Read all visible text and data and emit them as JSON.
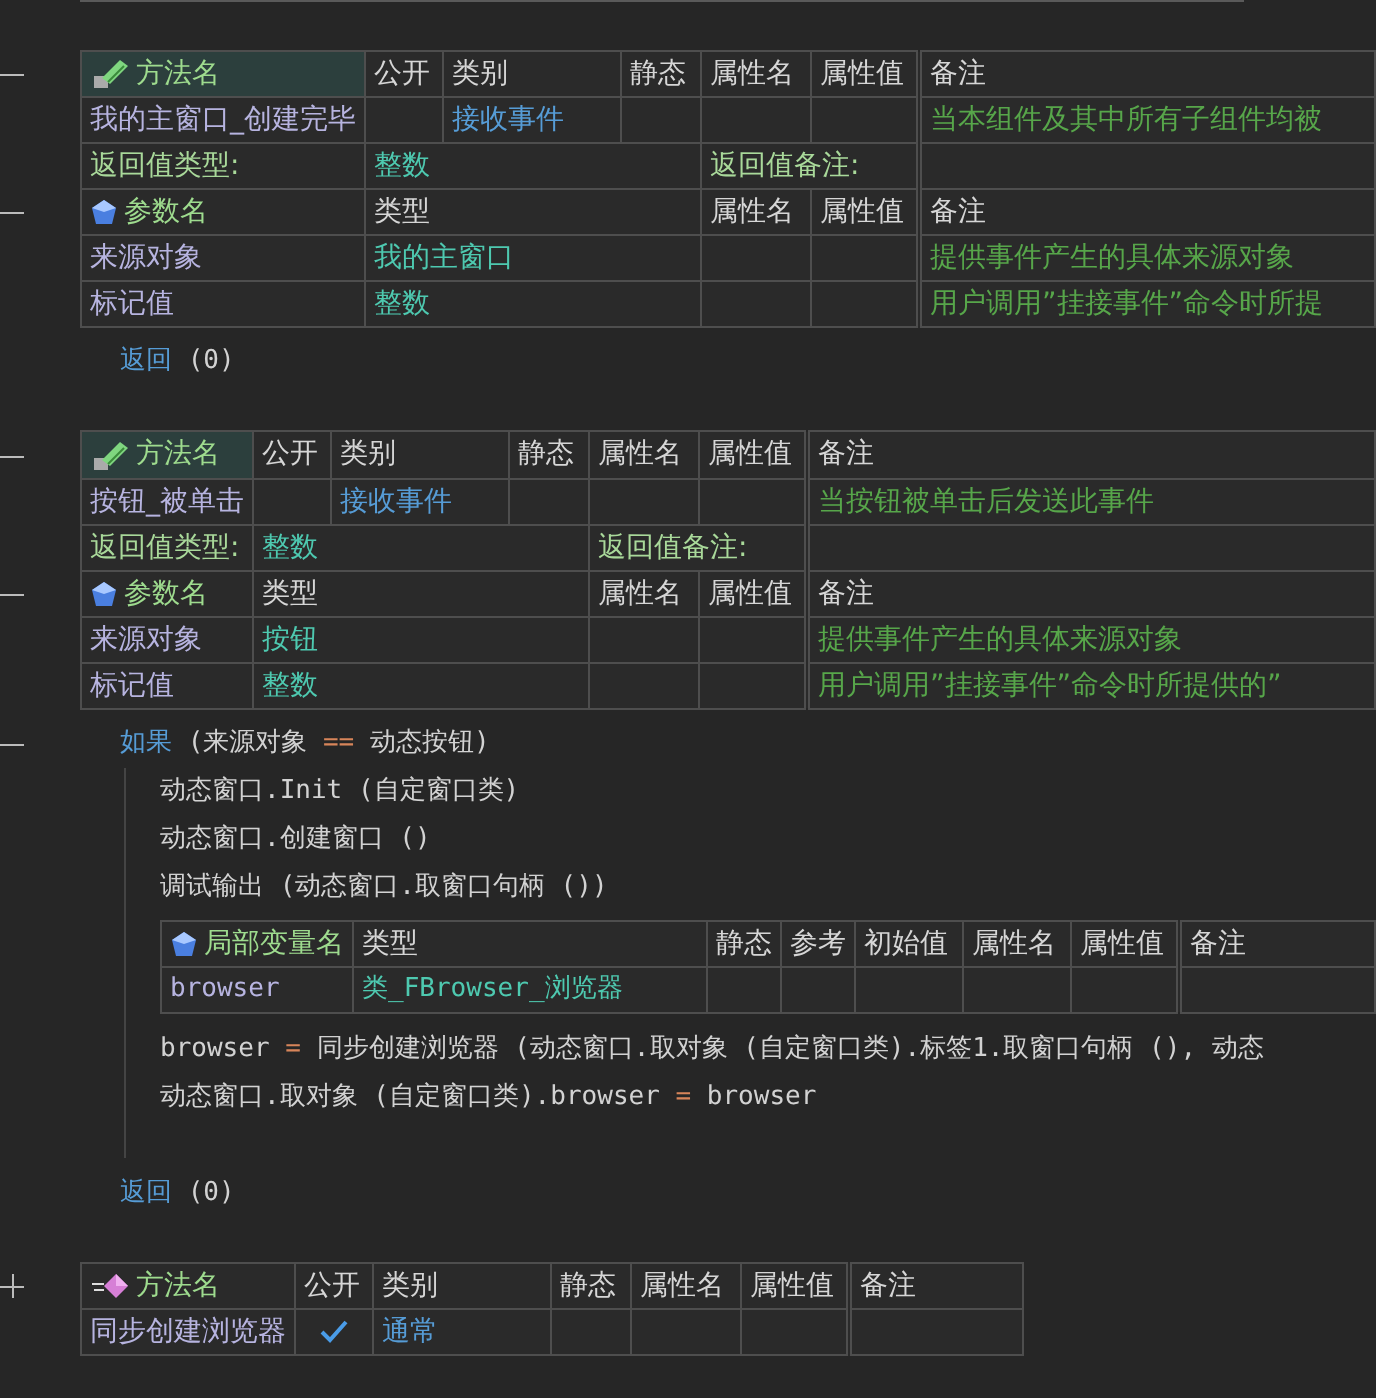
{
  "methods": [
    {
      "kind": "event",
      "expanded": true,
      "columns": [
        "方法名",
        "公开",
        "类别",
        "静态",
        "属性名",
        "属性值",
        "备注"
      ],
      "name": "我的主窗口_创建完毕",
      "public": false,
      "category": "接收事件",
      "note": "当本组件及其中所有子组件均被",
      "return_type_label": "返回值类型:",
      "return_type": "整数",
      "return_note_label": "返回值备注:",
      "params": {
        "expanded": true,
        "columns": [
          "参数名",
          "类型",
          "属性名",
          "属性值",
          "备注"
        ],
        "rows": [
          {
            "name": "来源对象",
            "type": "我的主窗口",
            "note": "提供事件产生的具体来源对象"
          },
          {
            "name": "标记值",
            "type": "整数",
            "note": "用户调用”挂接事件”命令时所提"
          }
        ]
      },
      "body": [
        {
          "kind": "return",
          "keyword": "返回",
          "args": " (0)"
        }
      ]
    },
    {
      "kind": "event",
      "expanded": true,
      "columns": [
        "方法名",
        "公开",
        "类别",
        "静态",
        "属性名",
        "属性值",
        "备注"
      ],
      "name": "按钮_被单击",
      "public": false,
      "category": "接收事件",
      "note": "当按钮被单击后发送此事件",
      "return_type_label": "返回值类型:",
      "return_type": "整数",
      "return_note_label": "返回值备注:",
      "params": {
        "expanded": true,
        "columns": [
          "参数名",
          "类型",
          "属性名",
          "属性值",
          "备注"
        ],
        "rows": [
          {
            "name": "来源对象",
            "type": "按钮",
            "note": "提供事件产生的具体来源对象"
          },
          {
            "name": "标记值",
            "type": "整数",
            "note": "用户调用”挂接事件”命令时所提供的”"
          }
        ]
      },
      "body": [
        {
          "kind": "if",
          "expanded": true,
          "keyword": "如果",
          "left": " (来源对象 ",
          "op": "==",
          "right": " 动态按钮)",
          "children": [
            {
              "kind": "line",
              "text": "动态窗口.Init (自定窗口类)"
            },
            {
              "kind": "line",
              "text": "动态窗口.创建窗口 ()"
            },
            {
              "kind": "line",
              "text": "调试输出 (动态窗口.取窗口句柄 ())"
            },
            {
              "kind": "locals",
              "columns": [
                "局部变量名",
                "类型",
                "静态",
                "参考",
                "初始值",
                "属性名",
                "属性值",
                "备注"
              ],
              "rows": [
                {
                  "name": "browser",
                  "type": "类_FBrowser_浏览器"
                }
              ]
            },
            {
              "kind": "assign",
              "target": "browser ",
              "op": "=",
              "value": " 同步创建浏览器 (动态窗口.取对象 (自定窗口类).标签1.取窗口句柄 (), 动态"
            },
            {
              "kind": "assign",
              "target": "动态窗口.取对象 (自定窗口类).browser ",
              "op": "=",
              "value": " browser"
            }
          ]
        },
        {
          "kind": "return",
          "keyword": "返回",
          "args": " (0)"
        }
      ]
    },
    {
      "kind": "sub",
      "expanded": false,
      "columns": [
        "方法名",
        "公开",
        "类别",
        "静态",
        "属性名",
        "属性值",
        "备注"
      ],
      "name": "同步创建浏览器",
      "public": true,
      "category": "通常"
    }
  ]
}
